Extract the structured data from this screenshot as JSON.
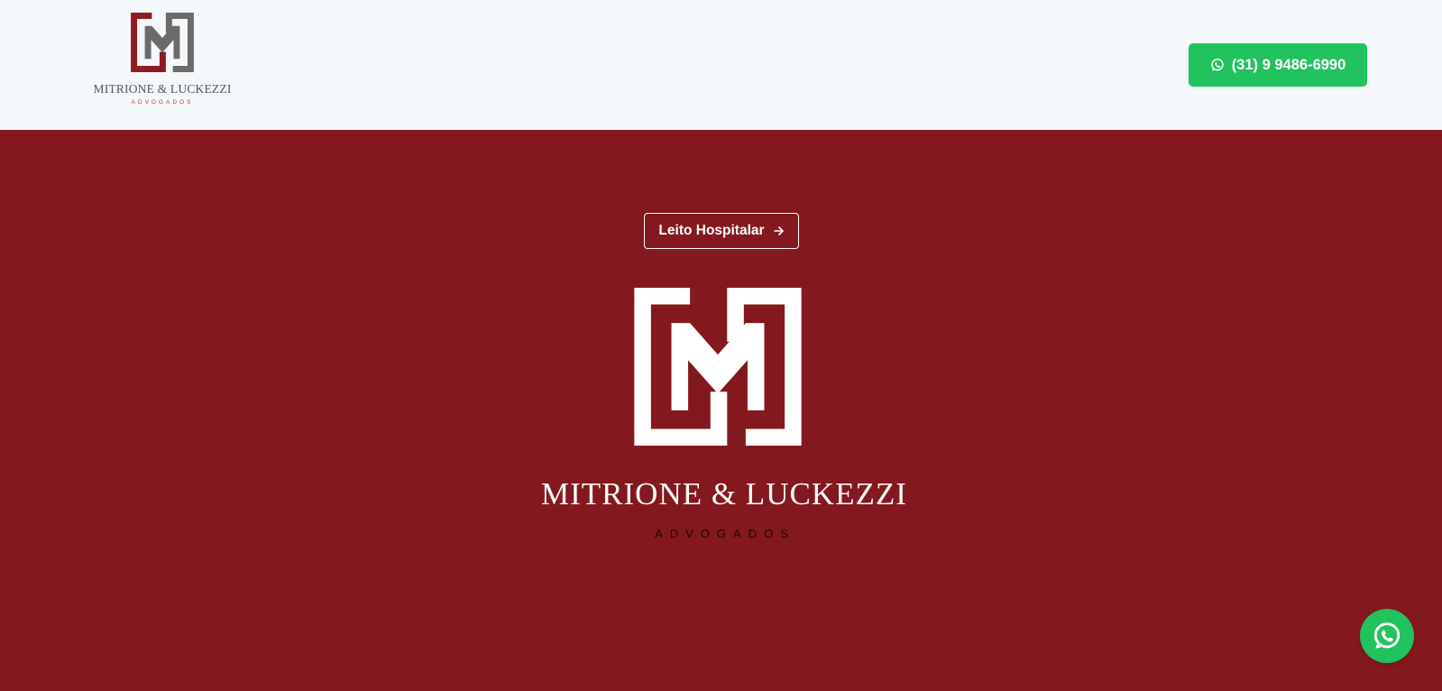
{
  "header": {
    "logo": {
      "brand_name": "MITRIONE & LUCKEZZI",
      "brand_sub": "ADVOGADOS",
      "icon": "mitrione-luckezzi-monogram-icon"
    },
    "phone_button": {
      "icon": "whatsapp-icon",
      "label": "(31) 9 9486-6990"
    }
  },
  "hero": {
    "category_pill": {
      "label": "Leito Hospitalar",
      "icon": "arrow-right-icon"
    },
    "brand_name": "MITRIONE & LUCKEZZI",
    "brand_sub": "ADVOGADOS",
    "logo_icon": "mitrione-luckezzi-monogram-icon"
  },
  "floating_button": {
    "icon": "whatsapp-icon"
  },
  "colors": {
    "header_background": "#f5f8fb",
    "hero_background": "#84181f",
    "whatsapp_green": "#22c25f",
    "brand_red": "#8e1c22",
    "brand_gray": "#6b6b6b"
  }
}
